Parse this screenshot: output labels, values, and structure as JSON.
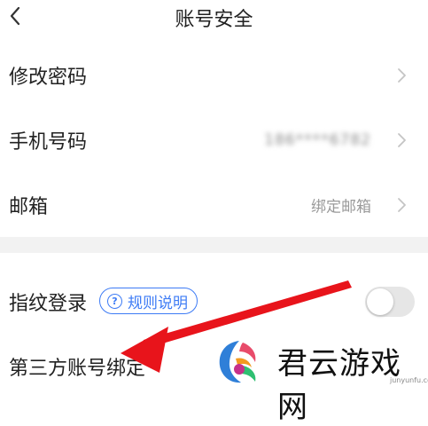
{
  "header": {
    "title": "账号安全",
    "back_icon": "chevron-left-icon"
  },
  "rows": [
    {
      "label": "修改密码",
      "value": "",
      "icon": "chevron-right-icon"
    },
    {
      "label": "手机号码",
      "value": "186****6782",
      "value_obscured": true,
      "icon": "chevron-right-icon"
    },
    {
      "label": "邮箱",
      "value": "绑定邮箱",
      "icon": "chevron-right-icon"
    }
  ],
  "fingerprint": {
    "label": "指纹登录",
    "rules_label": "规则说明",
    "rules_icon": "question-circle-icon",
    "toggle_on": false
  },
  "third_party": {
    "label": "第三方账号绑定"
  },
  "annotation": {
    "arrow_color": "#e8141b"
  },
  "watermark": {
    "text": "君云游戏网",
    "sub": "junyunfu.com"
  },
  "colors": {
    "accent": "#3d7bf5",
    "divider": "#f2f2f2",
    "secondary_text": "#9a9a9a"
  }
}
